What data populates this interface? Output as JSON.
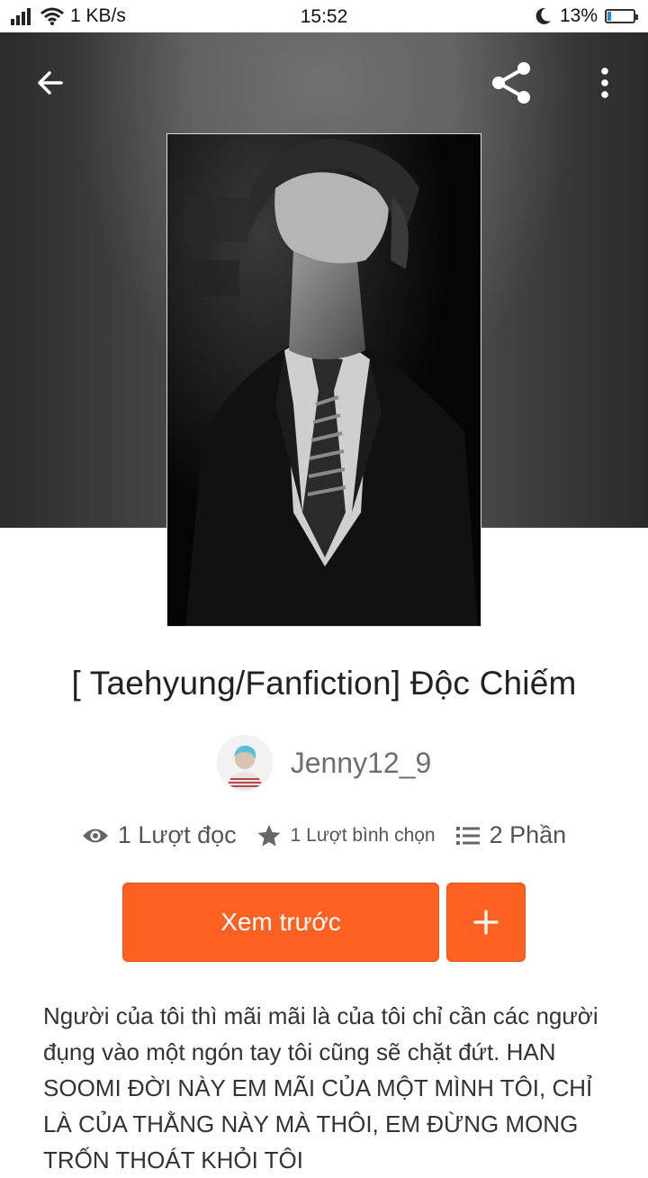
{
  "status_bar": {
    "network_speed": "1 KB/s",
    "time": "15:52",
    "battery": "13%",
    "battery_level": 0.13
  },
  "header": {
    "back_icon": "arrow-left-icon",
    "share_icon": "share-icon",
    "more_icon": "more-vertical-icon"
  },
  "story": {
    "title": "[ Taehyung/Fanfiction]  Độc Chiếm",
    "author": "Jenny12_9",
    "reads": "1 Lượt đọc",
    "votes": "1 Lượt bình chọn",
    "parts": "2 Phần",
    "preview_label": "Xem trước",
    "add_icon": "plus-icon",
    "description": "Người của tôi thì mãi mãi là của tôi chỉ cần các người đụng vào một ngón tay tôi cũng sẽ chặt đứt. HAN SOOMI ĐỜI NÀY EM MÃI CỦA MỘT MÌNH TÔI, CHỈ LÀ CỦA THẰNG NÀY MÀ THÔI, EM ĐỪNG MONG TRỐN THOÁT KHỎI TÔI"
  },
  "colors": {
    "accent": "#ff6122",
    "battery": "#1a8fe0"
  }
}
